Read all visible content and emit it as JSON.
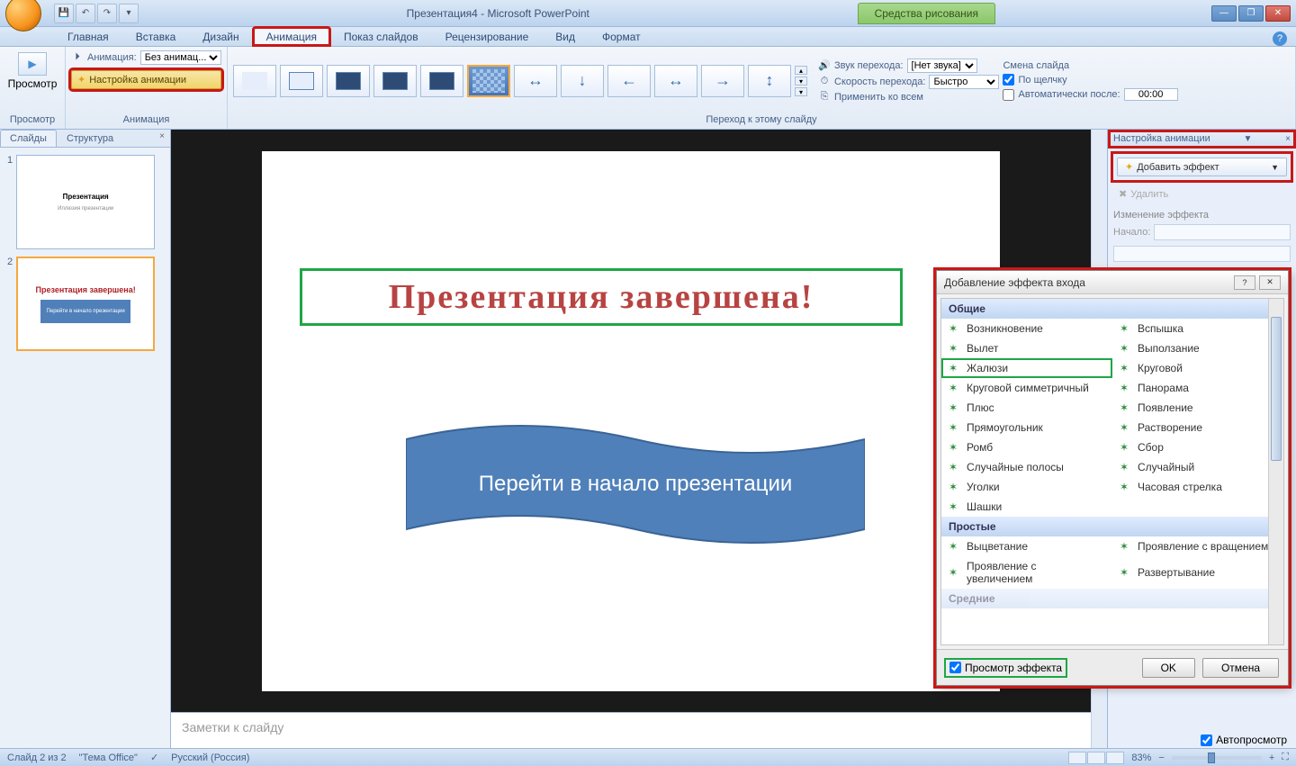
{
  "titlebar": {
    "doc_name": "Презентация4 - Microsoft PowerPoint",
    "contextual_tab": "Средства рисования"
  },
  "tabs": {
    "home": "Главная",
    "insert": "Вставка",
    "design": "Дизайн",
    "animation": "Анимация",
    "slideshow": "Показ слайдов",
    "review": "Рецензирование",
    "view": "Вид",
    "format": "Формат"
  },
  "ribbon": {
    "preview": "Просмотр",
    "preview_group": "Просмотр",
    "animation_label": "Анимация:",
    "animation_select": "Без анимац...",
    "animation_settings": "Настройка анимации",
    "animation_group": "Анимация",
    "transition_group": "Переход к этому слайду",
    "sound_label": "Звук перехода:",
    "sound_value": "[Нет звука]",
    "speed_label": "Скорость перехода:",
    "speed_value": "Быстро",
    "apply_all": "Применить ко всем",
    "change_slide_header": "Смена слайда",
    "on_click": "По щелчку",
    "auto_after": "Автоматически после:",
    "auto_time": "00:00"
  },
  "left_pane": {
    "tab_slides": "Слайды",
    "tab_outline": "Структура",
    "slide1_title": "Презентация",
    "slide1_sub": "Иллюзия презентации",
    "slide2_title": "Презентация завершена!",
    "slide2_banner": "Перейти в начало презентации"
  },
  "slide": {
    "title": "Презентация завершена!",
    "banner": "Перейти в начало презентации",
    "notes_placeholder": "Заметки к слайду"
  },
  "right_pane": {
    "header": "Настройка анимации",
    "add_effect": "Добавить эффект",
    "remove": "Удалить",
    "change_effect": "Изменение эффекта",
    "start_label": "Начало:",
    "autopreview": "Автопросмотр"
  },
  "effect_dialog": {
    "title": "Добавление эффекта входа",
    "cat_common": "Общие",
    "cat_simple": "Простые",
    "cat_next": "Средние",
    "common_effects_col1": [
      "Возникновение",
      "Вылет",
      "Жалюзи",
      "Круговой симметричный",
      "Плюс",
      "Прямоугольник",
      "Ромб",
      "Случайные полосы",
      "Уголки",
      "Шашки"
    ],
    "common_effects_col2": [
      "Вспышка",
      "Выползание",
      "Круговой",
      "Панорама",
      "Появление",
      "Растворение",
      "Сбор",
      "Случайный",
      "Часовая стрелка"
    ],
    "simple_effects_col1": [
      "Выцветание",
      "Проявление с увеличением"
    ],
    "simple_effects_col2": [
      "Проявление с вращением",
      "Развертывание"
    ],
    "selected": "Жалюзи",
    "preview_checkbox": "Просмотр эффекта",
    "ok": "OK",
    "cancel": "Отмена"
  },
  "statusbar": {
    "slide_info": "Слайд 2 из 2",
    "theme": "\"Тема Office\"",
    "language": "Русский (Россия)",
    "zoom": "83%"
  }
}
